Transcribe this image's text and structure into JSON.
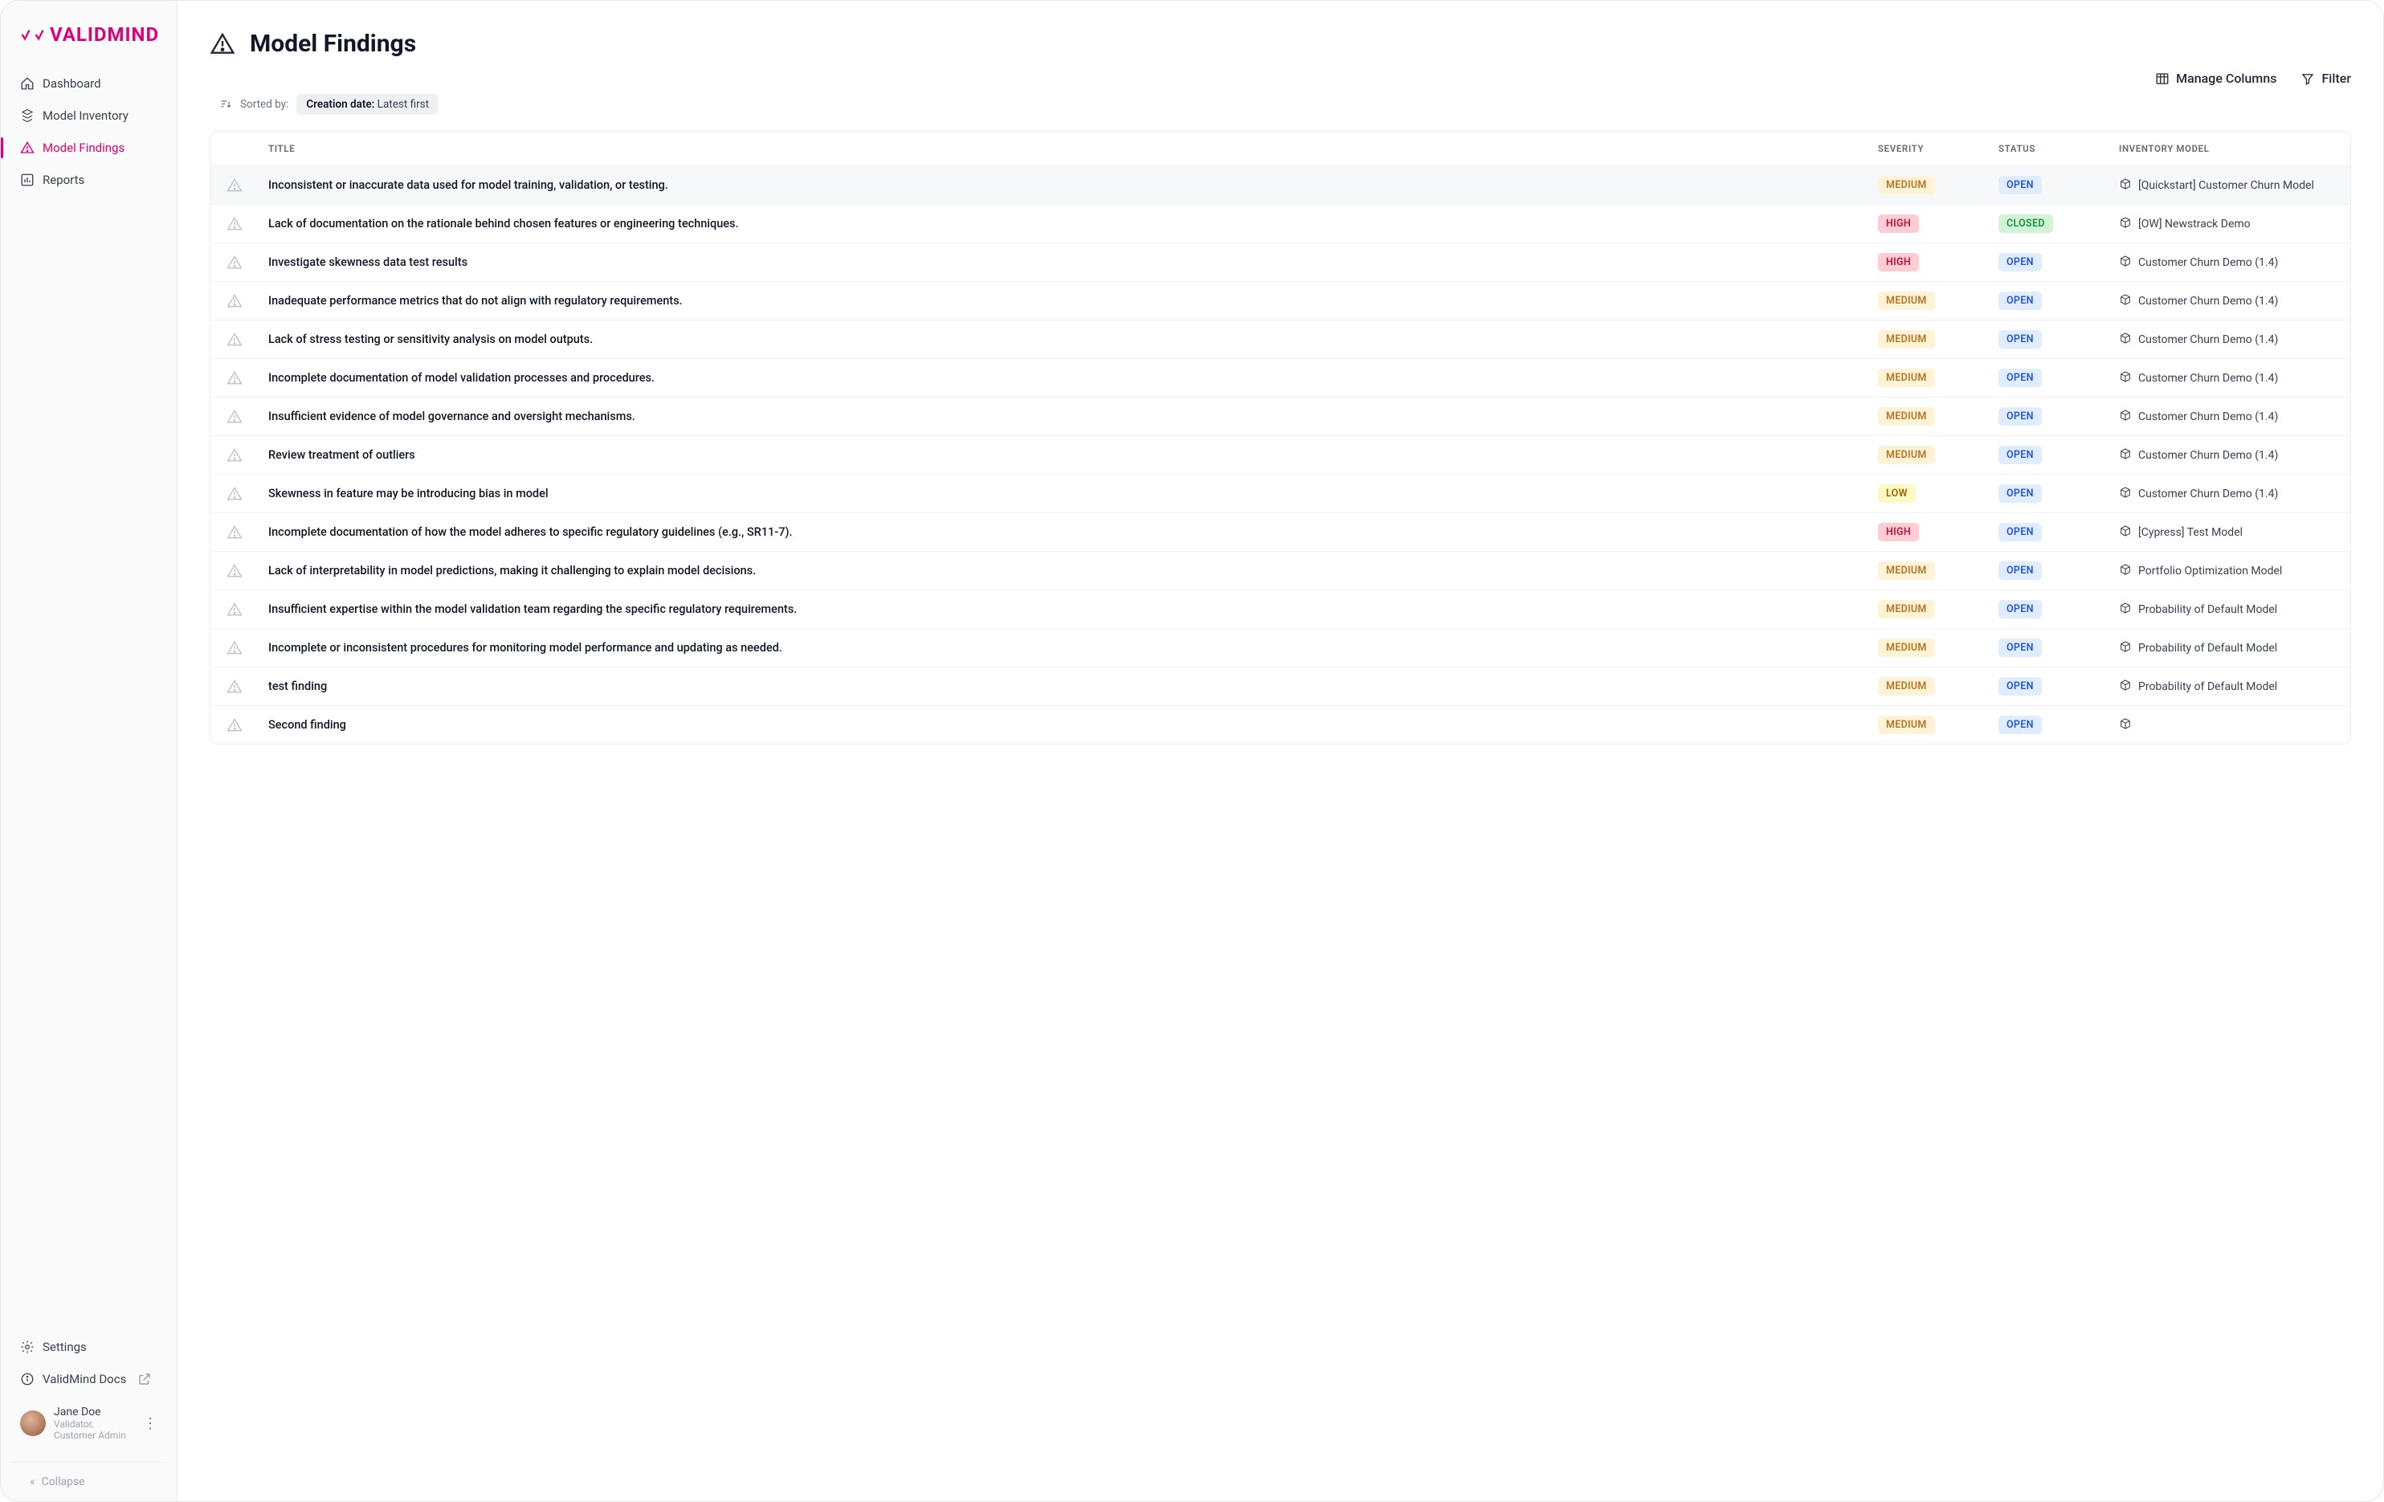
{
  "brand": {
    "name": "VALIDMIND"
  },
  "nav": {
    "dashboard": "Dashboard",
    "inventory": "Model Inventory",
    "findings": "Model Findings",
    "reports": "Reports"
  },
  "sidebar_bottom": {
    "settings": "Settings",
    "docs": "ValidMind Docs"
  },
  "user": {
    "name": "Jane Doe",
    "role": "Validator, Customer Admin"
  },
  "collapse_label": "Collapse",
  "page": {
    "title": "Model Findings",
    "manage_columns": "Manage Columns",
    "filter": "Filter",
    "sorted_by_label": "Sorted by:",
    "sort_field": "Creation date:",
    "sort_dir": "Latest first"
  },
  "columns": {
    "title": "TITLE",
    "severity": "SEVERITY",
    "status": "STATUS",
    "model": "INVENTORY MODEL"
  },
  "rows": [
    {
      "title": "Inconsistent or inaccurate data used for model training, validation, or testing.",
      "severity": "MEDIUM",
      "status": "OPEN",
      "model": "[Quickstart] Customer Churn Model"
    },
    {
      "title": "Lack of documentation on the rationale behind chosen features or engineering techniques.",
      "severity": "HIGH",
      "status": "CLOSED",
      "model": "[OW] Newstrack Demo"
    },
    {
      "title": "Investigate skewness data test results",
      "severity": "HIGH",
      "status": "OPEN",
      "model": "Customer Churn Demo (1.4)"
    },
    {
      "title": "Inadequate performance metrics that do not align with regulatory requirements.",
      "severity": "MEDIUM",
      "status": "OPEN",
      "model": "Customer Churn Demo (1.4)"
    },
    {
      "title": "Lack of stress testing or sensitivity analysis on model outputs.",
      "severity": "MEDIUM",
      "status": "OPEN",
      "model": "Customer Churn Demo (1.4)"
    },
    {
      "title": "Incomplete documentation of model validation processes and procedures.",
      "severity": "MEDIUM",
      "status": "OPEN",
      "model": "Customer Churn Demo (1.4)"
    },
    {
      "title": "Insufficient evidence of model governance and oversight mechanisms.",
      "severity": "MEDIUM",
      "status": "OPEN",
      "model": "Customer Churn Demo (1.4)"
    },
    {
      "title": "Review treatment of outliers",
      "severity": "MEDIUM",
      "status": "OPEN",
      "model": "Customer Churn Demo (1.4)"
    },
    {
      "title": "Skewness in feature may be introducing bias in model",
      "severity": "LOW",
      "status": "OPEN",
      "model": "Customer Churn Demo (1.4)"
    },
    {
      "title": "Incomplete documentation of how the model adheres to specific regulatory guidelines (e.g., SR11-7).",
      "severity": "HIGH",
      "status": "OPEN",
      "model": "[Cypress] Test Model"
    },
    {
      "title": "Lack of interpretability in model predictions, making it challenging to explain model decisions.",
      "severity": "MEDIUM",
      "status": "OPEN",
      "model": "Portfolio Optimization Model"
    },
    {
      "title": "Insufficient expertise within the model validation team regarding the specific regulatory requirements.",
      "severity": "MEDIUM",
      "status": "OPEN",
      "model": "Probability of Default Model"
    },
    {
      "title": "Incomplete or inconsistent procedures for monitoring model performance and updating as needed.",
      "severity": "MEDIUM",
      "status": "OPEN",
      "model": "Probability of Default Model"
    },
    {
      "title": "test finding",
      "severity": "MEDIUM",
      "status": "OPEN",
      "model": "Probability of Default Model"
    },
    {
      "title": "Second finding",
      "severity": "MEDIUM",
      "status": "OPEN",
      "model": ""
    }
  ]
}
